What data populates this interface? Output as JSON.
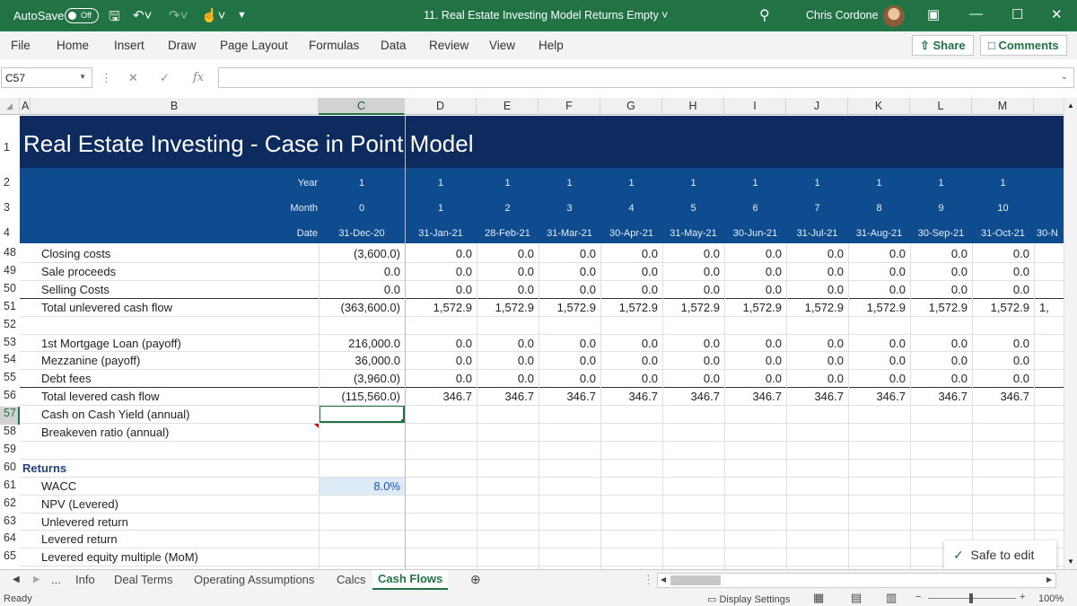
{
  "titlebar": {
    "autosave_label": "AutoSave",
    "autosave_state": "Off",
    "doc_title": "11. Real Estate Investing Model Returns Empty",
    "user_name": "Chris Cordone"
  },
  "ribbon": {
    "tabs": [
      "File",
      "Home",
      "Insert",
      "Draw",
      "Page Layout",
      "Formulas",
      "Data",
      "Review",
      "View",
      "Help"
    ],
    "share_label": "Share",
    "comments_label": "Comments"
  },
  "formula_bar": {
    "name_box": "C57",
    "formula": ""
  },
  "columns": [
    "A",
    "B",
    "C",
    "D",
    "E",
    "F",
    "G",
    "H",
    "I",
    "J",
    "K",
    "L",
    "M"
  ],
  "sheet": {
    "title": "Real Estate Investing - Case in Point Model",
    "header_rows": [
      {
        "row": "2",
        "label": "Year",
        "values": [
          "1",
          "1",
          "1",
          "1",
          "1",
          "1",
          "1",
          "1",
          "1",
          "1",
          "1"
        ]
      },
      {
        "row": "3",
        "label": "Month",
        "values": [
          "0",
          "1",
          "2",
          "3",
          "4",
          "5",
          "6",
          "7",
          "8",
          "9",
          "10"
        ]
      },
      {
        "row": "4",
        "label": "Date",
        "values": [
          "31-Dec-20",
          "31-Jan-21",
          "28-Feb-21",
          "31-Mar-21",
          "30-Apr-21",
          "31-May-21",
          "30-Jun-21",
          "31-Jul-21",
          "31-Aug-21",
          "30-Sep-21",
          "31-Oct-21"
        ],
        "overflow": "30-N"
      }
    ],
    "top_row_numbers": [
      "1",
      "2",
      "3",
      "4"
    ],
    "rows": [
      {
        "row": "48",
        "label": "Closing costs",
        "values": [
          "(3,600.0)",
          "0.0",
          "0.0",
          "0.0",
          "0.0",
          "0.0",
          "0.0",
          "0.0",
          "0.0",
          "0.0",
          "0.0"
        ]
      },
      {
        "row": "49",
        "label": "Sale proceeds",
        "values": [
          "0.0",
          "0.0",
          "0.0",
          "0.0",
          "0.0",
          "0.0",
          "0.0",
          "0.0",
          "0.0",
          "0.0",
          "0.0"
        ]
      },
      {
        "row": "50",
        "label": "Selling Costs",
        "values": [
          "0.0",
          "0.0",
          "0.0",
          "0.0",
          "0.0",
          "0.0",
          "0.0",
          "0.0",
          "0.0",
          "0.0",
          "0.0"
        ]
      },
      {
        "row": "51",
        "label": "Total unlevered cash flow",
        "values": [
          "(363,600.0)",
          "1,572.9",
          "1,572.9",
          "1,572.9",
          "1,572.9",
          "1,572.9",
          "1,572.9",
          "1,572.9",
          "1,572.9",
          "1,572.9",
          "1,572.9"
        ],
        "overflow": "1,"
      },
      {
        "row": "52",
        "label": "",
        "values": []
      },
      {
        "row": "53",
        "label": "1st Mortgage Loan (payoff)",
        "values": [
          "216,000.0",
          "0.0",
          "0.0",
          "0.0",
          "0.0",
          "0.0",
          "0.0",
          "0.0",
          "0.0",
          "0.0",
          "0.0"
        ]
      },
      {
        "row": "54",
        "label": "Mezzanine (payoff)",
        "values": [
          "36,000.0",
          "0.0",
          "0.0",
          "0.0",
          "0.0",
          "0.0",
          "0.0",
          "0.0",
          "0.0",
          "0.0",
          "0.0"
        ]
      },
      {
        "row": "55",
        "label": "Debt fees",
        "values": [
          "(3,960.0)",
          "0.0",
          "0.0",
          "0.0",
          "0.0",
          "0.0",
          "0.0",
          "0.0",
          "0.0",
          "0.0",
          "0.0"
        ]
      },
      {
        "row": "56",
        "label": "Total levered cash flow",
        "values": [
          "(115,560.0)",
          "346.7",
          "346.7",
          "346.7",
          "346.7",
          "346.7",
          "346.7",
          "346.7",
          "346.7",
          "346.7",
          "346.7"
        ]
      },
      {
        "row": "57",
        "label": "Cash on Cash Yield (annual)",
        "values": []
      },
      {
        "row": "58",
        "label": "Breakeven ratio (annual)",
        "values": []
      },
      {
        "row": "59",
        "label": "",
        "values": []
      },
      {
        "row": "60",
        "label": "Returns",
        "values": [],
        "section": true
      },
      {
        "row": "61",
        "label": "WACC",
        "values": [
          "8.0%"
        ],
        "input": true
      },
      {
        "row": "62",
        "label": "NPV (Levered)",
        "values": []
      },
      {
        "row": "63",
        "label": "Unlevered return",
        "values": []
      },
      {
        "row": "64",
        "label": "Levered return",
        "values": []
      },
      {
        "row": "65",
        "label": "Levered equity multiple (MoM)",
        "values": []
      }
    ]
  },
  "sheet_tabs": {
    "ellipsis": "...",
    "tabs": [
      "Info",
      "Deal Terms",
      "Operating Assumptions",
      "Calcs",
      "Cash Flows"
    ],
    "active": "Cash Flows"
  },
  "status": {
    "ready": "Ready",
    "display_settings": "Display Settings",
    "zoom": "100%",
    "safe_to_edit": "Safe to edit"
  },
  "colors": {
    "accent": "#217346",
    "banner": "#0d2b5e",
    "header_band": "#0f4c8f",
    "input_fill": "#ddebf7",
    "input_text": "#1f4fbf"
  }
}
